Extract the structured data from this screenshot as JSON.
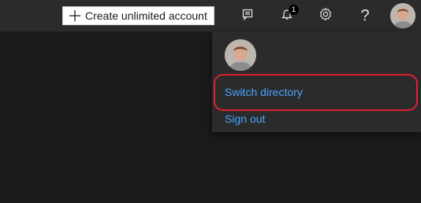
{
  "topbar": {
    "create_label": "Create unlimited account",
    "notification_count": "1",
    "help_label": "?",
    "icons": [
      "plus-icon",
      "feedback-icon",
      "bell-icon",
      "gear-icon",
      "help-icon",
      "avatar"
    ]
  },
  "account_menu": {
    "switch_directory": "Switch directory",
    "sign_out": "Sign out"
  },
  "colors": {
    "topbar_bg": "#2b2b2b",
    "page_bg": "#1b1b1b",
    "link": "#4aa3ff",
    "highlight": "#e0202e"
  }
}
